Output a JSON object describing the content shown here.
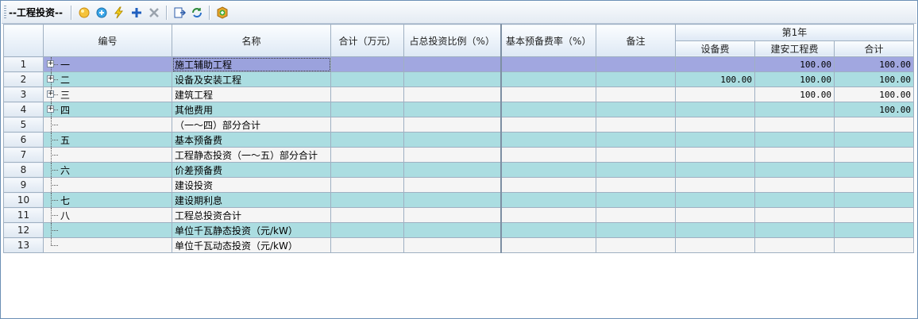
{
  "toolbar": {
    "title": "--工程投资--",
    "icons": [
      "add-item-icon",
      "insert-icon",
      "lightning-icon",
      "plus-icon",
      "delete-icon",
      "export-icon",
      "refresh-icon",
      "settings-icon"
    ]
  },
  "columns": {
    "code": "编号",
    "name": "名称",
    "total": "合计（万元）",
    "ratio": "占总投资比例（%）",
    "reserve_rate": "基本预备费率（%）",
    "remark": "备注",
    "year_group": "第1年",
    "equipment": "设备费",
    "construction": "建安工程费",
    "year_total": "合计"
  },
  "rows": [
    {
      "no": "1",
      "code": "一",
      "name": "施工辅助工程",
      "equipment": "",
      "construction": "100.00",
      "year_total": "100.00",
      "expand": true
    },
    {
      "no": "2",
      "code": "二",
      "name": "设备及安装工程",
      "equipment": "100.00",
      "construction": "100.00",
      "year_total": "100.00",
      "expand": true
    },
    {
      "no": "3",
      "code": "三",
      "name": "建筑工程",
      "equipment": "",
      "construction": "100.00",
      "year_total": "100.00",
      "expand": true
    },
    {
      "no": "4",
      "code": "四",
      "name": "其他费用",
      "equipment": "",
      "construction": "",
      "year_total": "100.00",
      "expand": true
    },
    {
      "no": "5",
      "code": "",
      "name": "（一～四）部分合计",
      "equipment": "",
      "construction": "",
      "year_total": "",
      "expand": false
    },
    {
      "no": "6",
      "code": "五",
      "name": "基本预备费",
      "equipment": "",
      "construction": "",
      "year_total": "",
      "expand": false
    },
    {
      "no": "7",
      "code": "",
      "name": "工程静态投资（一～五）部分合计",
      "equipment": "",
      "construction": "",
      "year_total": "",
      "expand": false
    },
    {
      "no": "8",
      "code": "六",
      "name": "价差预备费",
      "equipment": "",
      "construction": "",
      "year_total": "",
      "expand": false
    },
    {
      "no": "9",
      "code": "",
      "name": "建设投资",
      "equipment": "",
      "construction": "",
      "year_total": "",
      "expand": false
    },
    {
      "no": "10",
      "code": "七",
      "name": "建设期利息",
      "equipment": "",
      "construction": "",
      "year_total": "",
      "expand": false
    },
    {
      "no": "11",
      "code": "八",
      "name": "工程总投资合计",
      "equipment": "",
      "construction": "",
      "year_total": "",
      "expand": false
    },
    {
      "no": "12",
      "code": "",
      "name": "单位千瓦静态投资（元/kW）",
      "equipment": "",
      "construction": "",
      "year_total": "",
      "expand": false
    },
    {
      "no": "13",
      "code": "",
      "name": "单位千瓦动态投资（元/kW）",
      "equipment": "",
      "construction": "",
      "year_total": "",
      "expand": false
    }
  ]
}
